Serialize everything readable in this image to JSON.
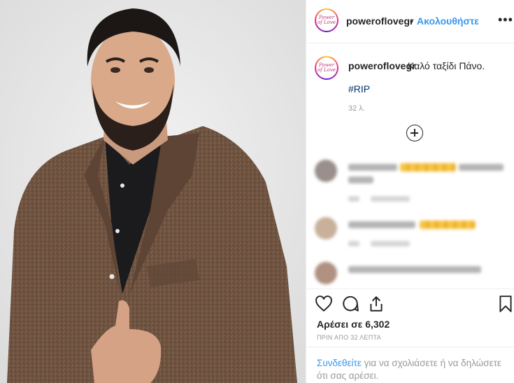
{
  "post": {
    "username": "poweroflovegr",
    "avatar_text": "Power of Love",
    "dot": "•",
    "follow_label": "Ακολουθήστε",
    "more_label": "•••",
    "caption": {
      "username": "poweroflovegr",
      "text": "Καλό ταξίδι Πάνο.",
      "hashtag": "#RIP",
      "time": "32 λ."
    },
    "likes": "Αρέσει σε 6,302",
    "timestamp": "ΠΡΙΝ ΑΠΟ 32 ΛΕΠΤΑ",
    "login_prompt": {
      "link": "Συνδεθείτε",
      "text": " για να σχολιάσετε ή να δηλώσετε ότι σας αρέσει."
    }
  },
  "icons": {
    "like": "heart-icon",
    "comment": "comment-icon",
    "share": "share-icon",
    "save": "bookmark-icon",
    "load_more": "plus-circle-icon"
  },
  "colors": {
    "link": "#3897f0",
    "hashtag": "#003569",
    "text": "#262626",
    "muted": "#999999"
  }
}
